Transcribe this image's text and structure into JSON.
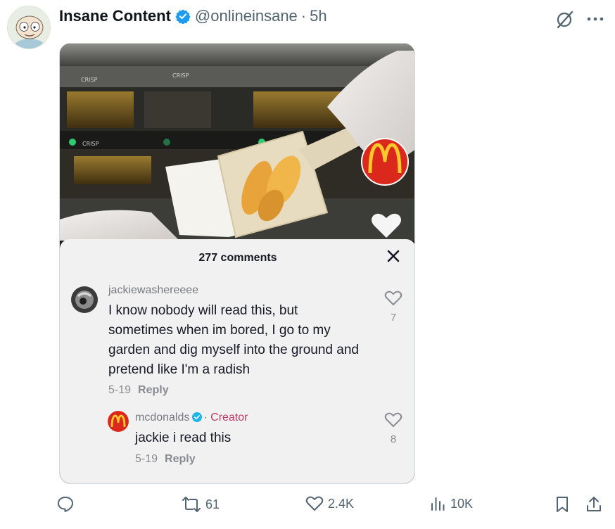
{
  "tweet": {
    "author_name": "Insane Content",
    "handle": "@onlineinsane",
    "separator": "·",
    "time": "5h"
  },
  "video_overlay": {
    "fryer_labels": [
      "CRISP",
      "CRISP",
      "CRISP"
    ]
  },
  "comments_panel": {
    "title": "277 comments",
    "comments": [
      {
        "username": "jackiewashereeee",
        "text": "I know nobody will read this, but sometimes when im bored, I go to my garden and dig myself into the ground and pretend like I'm a radish",
        "date": "5-19",
        "reply_label": "Reply",
        "likes": "7"
      },
      {
        "username": "mcdonalds",
        "badge_separator": "·",
        "badge": "Creator",
        "text": "jackie i read this",
        "date": "5-19",
        "reply_label": "Reply",
        "likes": "8"
      }
    ]
  },
  "actions": {
    "replies": "",
    "retweets": "61",
    "likes": "2.4K",
    "views": "10K"
  },
  "colors": {
    "verified_blue": "#1d9bf0",
    "mcdonalds_red": "#da291c",
    "mcdonalds_yellow": "#ffc72c",
    "creator_pink": "#c03a66"
  },
  "icons": [
    "verified-badge-icon",
    "grok-icon",
    "more-icon",
    "heart-icon",
    "close-icon",
    "reply-icon",
    "retweet-icon",
    "views-icon",
    "bookmark-icon",
    "share-icon"
  ]
}
